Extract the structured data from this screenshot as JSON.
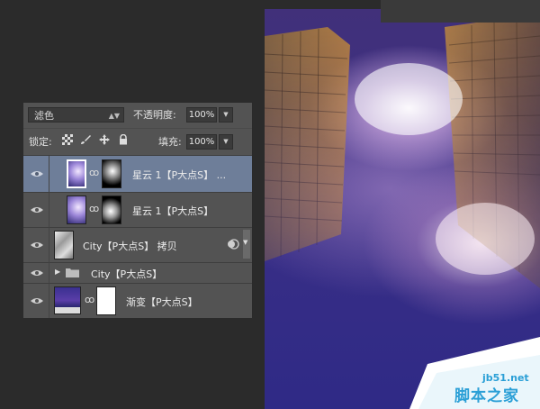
{
  "layers_panel": {
    "blend_mode": "滤色",
    "opacity_label": "不透明度:",
    "opacity_value": "100%",
    "lock_label": "锁定:",
    "fill_label": "填充:",
    "fill_value": "100%",
    "layers": [
      {
        "name": "星云 1【P大点S】 ...",
        "selected": true,
        "type": "masked"
      },
      {
        "name": "星云 1【P大点S】",
        "selected": false,
        "type": "masked"
      },
      {
        "name": "City【P大点S】 拷贝",
        "selected": false,
        "type": "smart-object"
      },
      {
        "name": "City【P大点S】",
        "selected": false,
        "type": "group"
      },
      {
        "name": "渐变【P大点S】",
        "selected": false,
        "type": "gradient-masked"
      }
    ]
  },
  "watermark": {
    "url": "jb51.net",
    "site_name": "脚本之家"
  },
  "colors": {
    "panel_bg": "#535353",
    "selected_layer": "#6e7e99",
    "watermark_blue": "#2a9fd6"
  }
}
